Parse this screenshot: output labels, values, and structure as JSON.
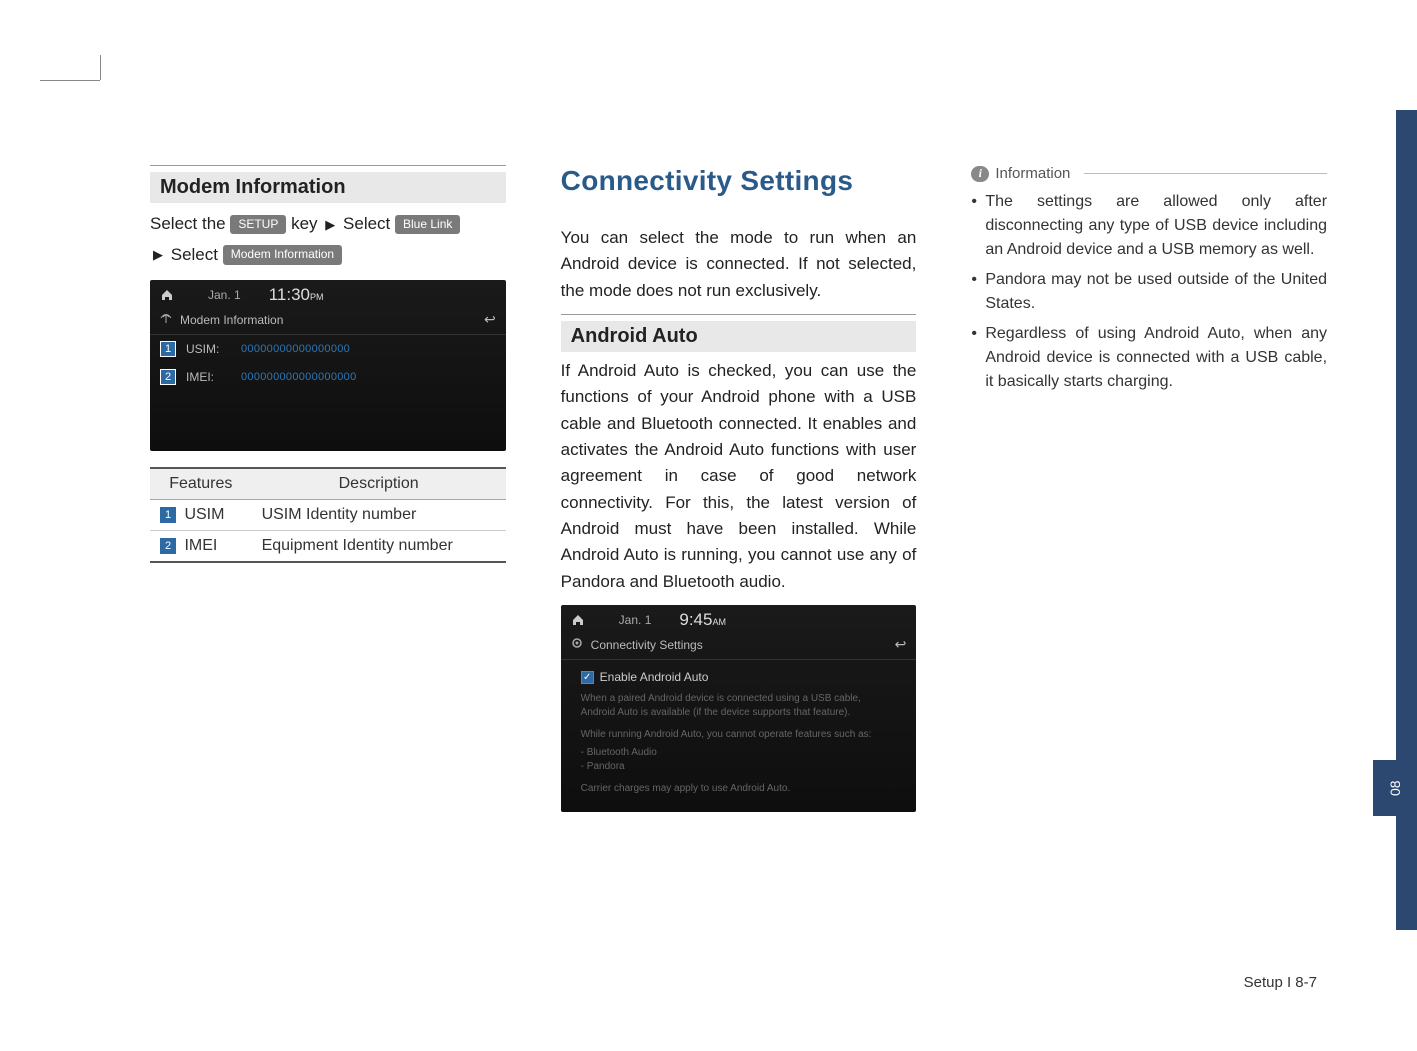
{
  "col1": {
    "heading": "Modem Information",
    "instr_prefix1": "Select the",
    "pill_setup": "SETUP",
    "instr_key": "key",
    "instr_select": "Select",
    "pill_bluelink": "Blue Link",
    "pill_modem": "Modem Information",
    "screenshot": {
      "date": "Jan.   1",
      "time": "11:30",
      "time_suffix": "PM",
      "title": "Modem Information",
      "rows": [
        {
          "num": "1",
          "label": "USIM:",
          "value": "00000000000000000"
        },
        {
          "num": "2",
          "label": "IMEI:",
          "value": "000000000000000000"
        }
      ]
    },
    "table": {
      "headers": [
        "Features",
        "Description"
      ],
      "rows": [
        {
          "num": "1",
          "feat": "USIM",
          "desc": "USIM Identity number"
        },
        {
          "num": "2",
          "feat": "IMEI",
          "desc": "Equipment Identity number"
        }
      ]
    }
  },
  "col2": {
    "title": "Connectivity Settings",
    "intro": "You can select the mode to run when an Android device is connected. If not selected, the mode does not run exclusively.",
    "heading": "Android Auto",
    "body": "If Android Auto is checked, you can use the functions of your Android phone with a USB cable and Bluetooth connected. It enables and activates the Android Auto functions with user agreement in case of good network connectivity. For this, the latest version of Android must have been installed. While Android Auto is running, you cannot use any of Pandora and Bluetooth audio.",
    "screenshot": {
      "date": "Jan.   1",
      "time": "9:45",
      "time_suffix": "AM",
      "title": "Connectivity Settings",
      "checkbox_label": "Enable Android Auto",
      "line1": "When a paired Android device is connected using a USB cable, Android Auto is available (if the device supports that feature).",
      "line2": "While running Android Auto, you cannot operate features such as:",
      "line3a": "- Bluetooth Audio",
      "line3b": "- Pandora",
      "line4": "Carrier charges may apply to use Android Auto."
    }
  },
  "col3": {
    "info_label": "Information",
    "items": [
      "The settings are allowed only after disconnecting any type of USB device including an Android device and a USB memory as well.",
      "Pandora may not be used outside of the United States.",
      "Regardless of using Android Auto, when any Android device is connected with a USB cable, it basically starts charging."
    ]
  },
  "footer": "Setup I 8-7",
  "side_tab": "08"
}
